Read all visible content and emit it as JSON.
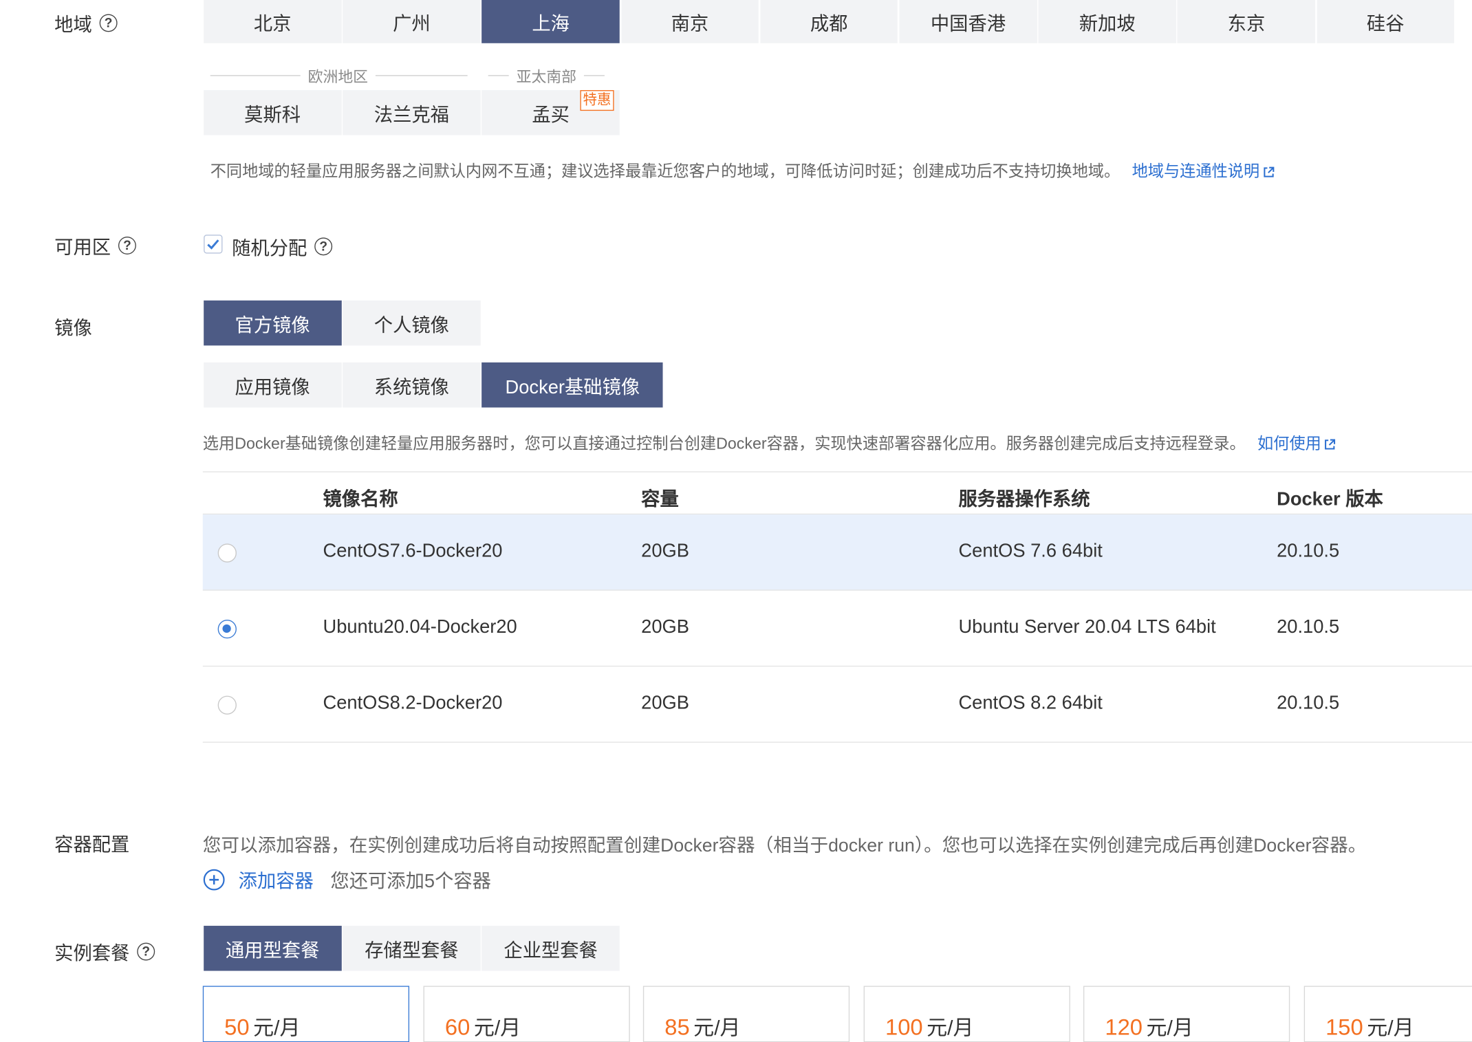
{
  "region": {
    "label": "地域",
    "tabs": [
      "北京",
      "广州",
      "上海",
      "南京",
      "成都",
      "中国香港",
      "新加坡",
      "东京",
      "硅谷"
    ],
    "active_index": 2,
    "europe_group_label": "欧洲地区",
    "apac_south_group_label": "亚太南部",
    "extra_tabs": [
      "莫斯科",
      "法兰克福",
      "孟买"
    ],
    "promo_badge": "特惠",
    "hint": "不同地域的轻量应用服务器之间默认内网不互通；建议选择最靠近您客户的地域，可降低访问时延；创建成功后不支持切换地域。",
    "hint_link": "地域与连通性说明"
  },
  "zone": {
    "label": "可用区",
    "checkbox_label": "随机分配",
    "checked": true
  },
  "image": {
    "label": "镜像",
    "source_tabs": [
      "官方镜像",
      "个人镜像"
    ],
    "source_active_index": 0,
    "type_tabs": [
      "应用镜像",
      "系统镜像",
      "Docker基础镜像"
    ],
    "type_active_index": 2,
    "hint": "选用Docker基础镜像创建轻量应用服务器时，您可以直接通过控制台创建Docker容器，实现快速部署容器化应用。服务器创建完成后支持远程登录。",
    "hint_link": "如何使用",
    "table": {
      "columns": [
        "镜像名称",
        "容量",
        "服务器操作系统",
        "Docker 版本"
      ],
      "rows": [
        {
          "name": "CentOS7.6-Docker20",
          "capacity": "20GB",
          "os": "CentOS 7.6 64bit",
          "docker": "20.10.5",
          "selected": false,
          "highlight": true
        },
        {
          "name": "Ubuntu20.04-Docker20",
          "capacity": "20GB",
          "os": "Ubuntu Server 20.04 LTS 64bit",
          "docker": "20.10.5",
          "selected": true,
          "highlight": false
        },
        {
          "name": "CentOS8.2-Docker20",
          "capacity": "20GB",
          "os": "CentOS 8.2 64bit",
          "docker": "20.10.5",
          "selected": false,
          "highlight": false
        }
      ]
    }
  },
  "container": {
    "label": "容器配置",
    "hint": "您可以添加容器，在实例创建成功后将自动按照配置创建Docker容器（相当于docker run）。您也可以选择在实例创建完成后再创建Docker容器。",
    "add_label": "添加容器",
    "remaining": "您还可添加5个容器"
  },
  "plan": {
    "label": "实例套餐",
    "tabs": [
      "通用型套餐",
      "存储型套餐",
      "企业型套餐"
    ],
    "active_index": 0,
    "cards": [
      {
        "price": "50",
        "unit": "元/月"
      },
      {
        "price": "60",
        "unit": "元/月"
      },
      {
        "price": "85",
        "unit": "元/月"
      },
      {
        "price": "100",
        "unit": "元/月"
      },
      {
        "price": "120",
        "unit": "元/月"
      },
      {
        "price": "150",
        "unit": "元/月"
      }
    ],
    "selected_index": 0
  },
  "colors": {
    "active_tab": "#4d5b85",
    "tab_bg": "#f2f3f5",
    "link": "#2c6fd0",
    "accent_orange": "#f37021",
    "row_highlight": "#e8f0fc",
    "radio_checked": "#3a7bd5"
  },
  "icons": {
    "help": "question-circle-icon",
    "external": "external-link-icon",
    "checkbox": "check-icon",
    "add": "plus-circle-icon"
  }
}
